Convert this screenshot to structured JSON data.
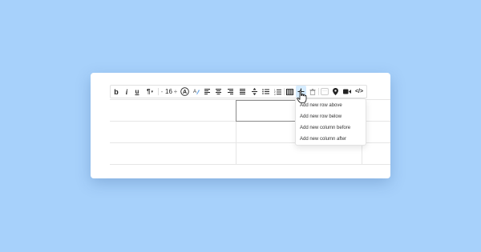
{
  "toolbar": {
    "bold": "b",
    "italic": "i",
    "underline": "u",
    "paragraph": "¶",
    "font_size": "16",
    "decrease": "-",
    "increase": "+",
    "code_label": "</>",
    "more": "···",
    "paragraph_caret": "▾"
  },
  "table_menu": {
    "items": [
      "Add new row above",
      "Add new row below",
      "Add new column before",
      "Add new column after"
    ]
  },
  "icons": {
    "cursor": "hand-pointer-icon"
  }
}
